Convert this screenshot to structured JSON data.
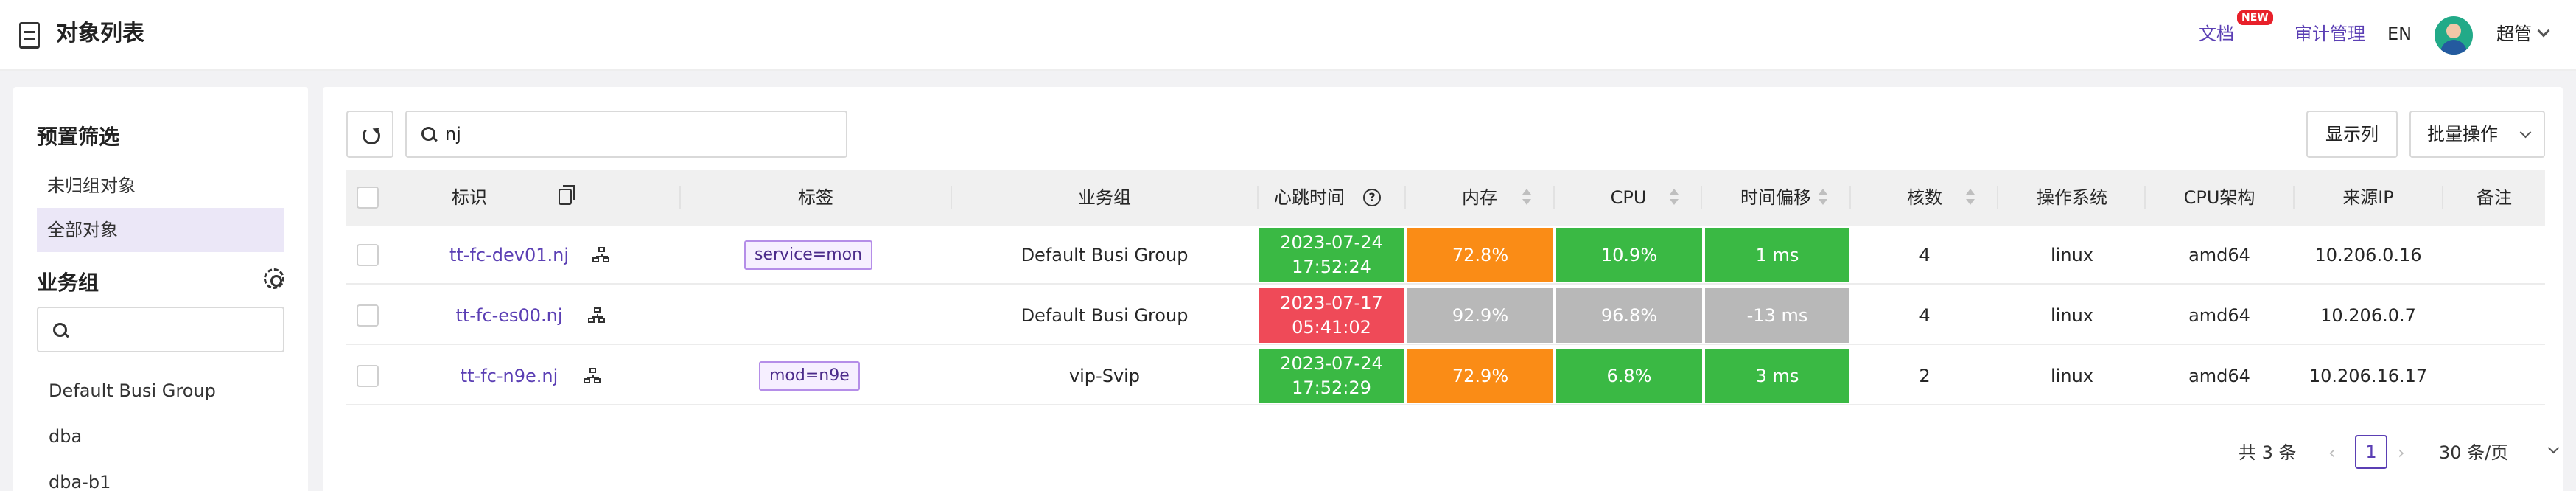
{
  "header": {
    "page_icon": "table-list-icon",
    "title": "对象列表",
    "docs": "文档",
    "new_badge": "NEW",
    "audit": "审计管理",
    "lang": "EN",
    "user": "超管"
  },
  "sidebar": {
    "presets_title": "预置筛选",
    "presets": [
      "未归组对象",
      "全部对象"
    ],
    "selected_preset": "全部对象",
    "groups_title": "业务组",
    "search_placeholder": "",
    "groups": [
      "Default Busi Group",
      "dba",
      "dba-b1"
    ]
  },
  "toolbar": {
    "search_value": "nj",
    "show_columns": "显示列",
    "batch_ops": "批量操作"
  },
  "table": {
    "columns": [
      "标识",
      "标签",
      "业务组",
      "心跳时间",
      "内存",
      "CPU",
      "时间偏移",
      "核数",
      "操作系统",
      "CPU架构",
      "来源IP",
      "备注"
    ],
    "rows": [
      {
        "ident": "tt-fc-dev01.nj",
        "tags": [
          "service=mon"
        ],
        "group": "Default Busi Group",
        "heartbeat_date": "2023-07-24",
        "heartbeat_time": "17:52:24",
        "mem": "72.8%",
        "cpu": "10.9%",
        "offset": "1 ms",
        "cores": "4",
        "os": "linux",
        "arch": "amd64",
        "ip": "10.206.0.16",
        "note": ""
      },
      {
        "ident": "tt-fc-es00.nj",
        "tags": [],
        "group": "Default Busi Group",
        "heartbeat_date": "2023-07-17",
        "heartbeat_time": "05:41:02",
        "mem": "92.9%",
        "cpu": "96.8%",
        "offset": "-13 ms",
        "cores": "4",
        "os": "linux",
        "arch": "amd64",
        "ip": "10.206.0.7",
        "note": ""
      },
      {
        "ident": "tt-fc-n9e.nj",
        "tags": [
          "mod=n9e"
        ],
        "group": "vip-Svip",
        "heartbeat_date": "2023-07-24",
        "heartbeat_time": "17:52:29",
        "mem": "72.9%",
        "cpu": "6.8%",
        "offset": "3 ms",
        "cores": "2",
        "os": "linux",
        "arch": "amd64",
        "ip": "10.206.16.17",
        "note": ""
      }
    ]
  },
  "status_colors": {
    "ok": "#3ab944",
    "warn": "#fa8c16",
    "down": "#ef4a58",
    "stale": "#b8b8b8"
  },
  "cell_status": [
    {
      "heartbeat": "ok",
      "mem": "warn",
      "cpu": "ok",
      "offset": "ok"
    },
    {
      "heartbeat": "down",
      "mem": "stale",
      "cpu": "stale",
      "offset": "stale"
    },
    {
      "heartbeat": "ok",
      "mem": "warn",
      "cpu": "ok",
      "offset": "ok"
    }
  ],
  "pagination": {
    "total": "共 3 条",
    "prev": "‹",
    "current": "1",
    "next": "›",
    "page_size": "30 条/页"
  }
}
